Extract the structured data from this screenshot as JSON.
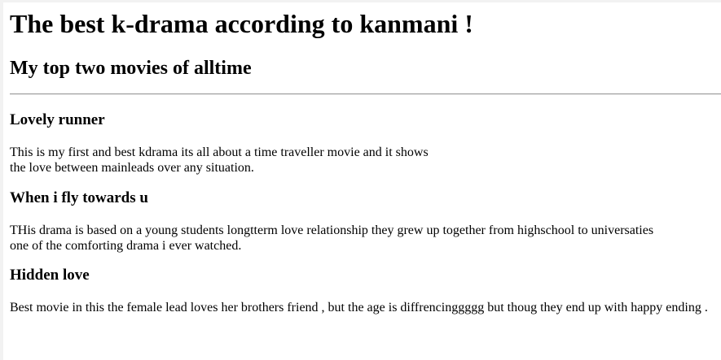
{
  "page": {
    "title": "The best k-drama according to kanmani !",
    "subtitle": "My top two movies of alltime"
  },
  "dramas": [
    {
      "title": "Lovely runner",
      "lines": [
        "This is my first and best kdrama its all about a time traveller movie and it shows",
        "the love between mainleads over any situation."
      ]
    },
    {
      "title": "When i fly towards u",
      "lines": [
        "THis drama is based on a young students longtterm love relationship they grew up together from highschool to universaties",
        "one of the comforting drama i ever watched."
      ]
    },
    {
      "title": "Hidden love",
      "lines": [
        "Best movie in this the female lead loves her brothers friend , but the age is diffrencinggggg but thoug they end up with happy ending ."
      ]
    }
  ]
}
